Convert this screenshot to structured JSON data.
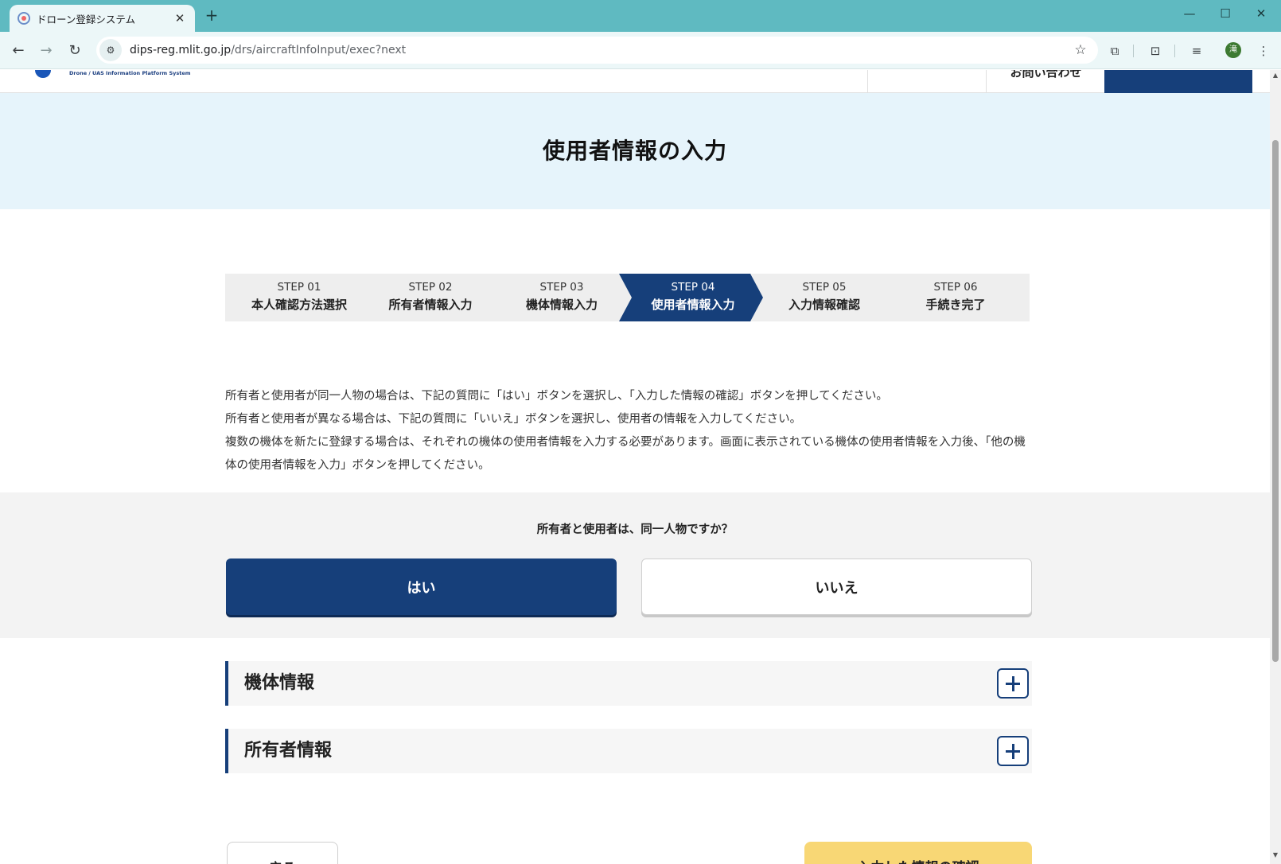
{
  "browser": {
    "tab_title": "ドローン登録システム",
    "tab_close": "✕",
    "new_tab": "+",
    "url_host": "dips-reg.mlit.go.jp",
    "url_path": "/drs/aircraftInfoInput/exec?next",
    "avatar_initial": "滝"
  },
  "site_header": {
    "logo_sub": "Drone / UAS Information Platform System",
    "contact": "お問い合わせ"
  },
  "page": {
    "title": "使用者情報の入力"
  },
  "steps": [
    {
      "num": "STEP 01",
      "label": "本人確認方法選択",
      "active": false
    },
    {
      "num": "STEP 02",
      "label": "所有者情報入力",
      "active": false
    },
    {
      "num": "STEP 03",
      "label": "機体情報入力",
      "active": false
    },
    {
      "num": "STEP 04",
      "label": "使用者情報入力",
      "active": true
    },
    {
      "num": "STEP 05",
      "label": "入力情報確認",
      "active": false
    },
    {
      "num": "STEP 06",
      "label": "手続き完了",
      "active": false
    }
  ],
  "instructions": [
    "所有者と使用者が同一人物の場合は、下記の質問に「はい」ボタンを選択し、「入力した情報の確認」ボタンを押してください。",
    "所有者と使用者が異なる場合は、下記の質問に「いいえ」ボタンを選択し、使用者の情報を入力してください。",
    "複数の機体を新たに登録する場合は、それぞれの機体の使用者情報を入力する必要があります。画面に表示されている機体の使用者情報を入力後、「他の機体の使用者情報を入力」ボタンを押してください。"
  ],
  "question": {
    "text": "所有者と使用者は、同一人物ですか？",
    "yes_label": "はい",
    "no_label": "いいえ",
    "selected": "yes"
  },
  "accordions": [
    {
      "label": "機体情報"
    },
    {
      "label": "所有者情報"
    }
  ],
  "footer_buttons": {
    "back_label": "戻る",
    "confirm_label": "入力した情報の確認"
  },
  "colors": {
    "primary": "#163f7a",
    "title_band": "#e6f4fb",
    "accent_yellow": "#f8d775",
    "browser_frame": "#5fbac1"
  }
}
